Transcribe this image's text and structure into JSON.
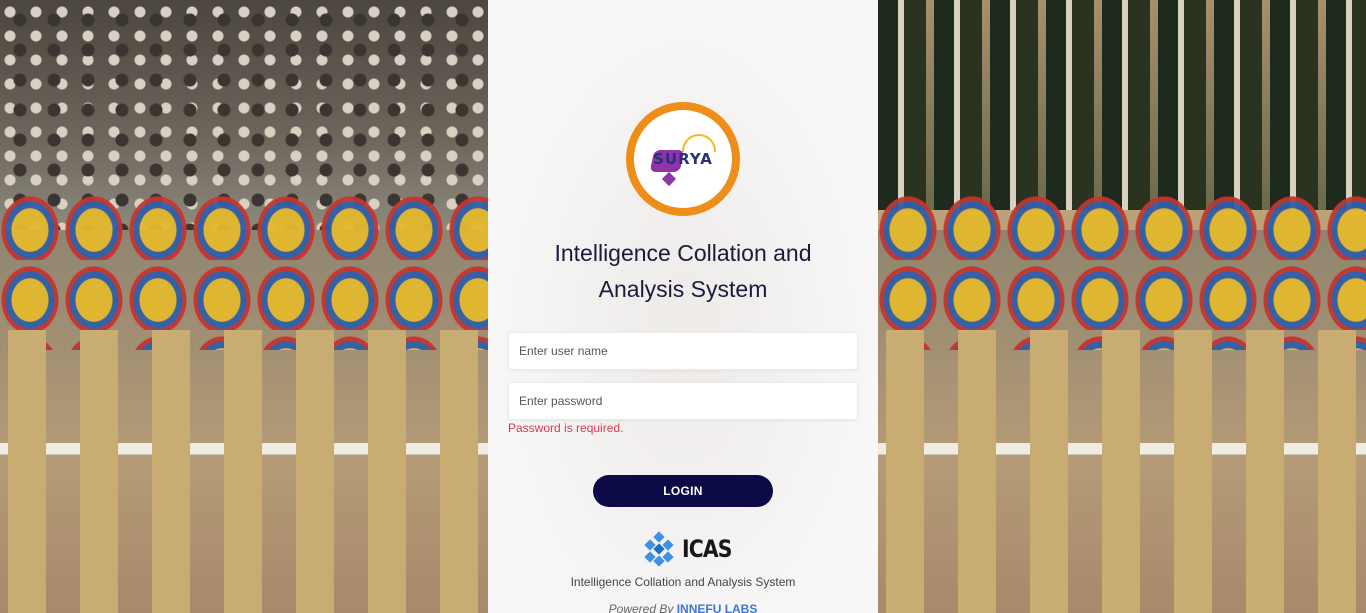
{
  "logo": {
    "text": "SURYA",
    "icon": "surya-logo"
  },
  "title": "Intelligence Collation and Analysis System",
  "login_form": {
    "username_placeholder": "Enter user name",
    "password_placeholder": "Enter password",
    "password_error": "Password is required.",
    "login_label": "LOGIN"
  },
  "footer": {
    "brand": "ICAS",
    "subtitle": "Intelligence Collation and Analysis System",
    "powered_prefix": "Powered By",
    "powered_company": "INNEFU LABS"
  },
  "colors": {
    "accent": "#0c0b47",
    "error": "#d9394f",
    "logo_ring": "#ef8d1b",
    "link": "#3c77d6"
  }
}
